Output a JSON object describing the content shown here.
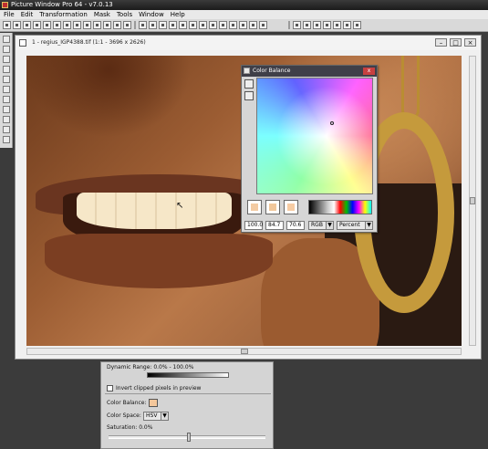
{
  "app": {
    "title": "Picture Window Pro 64 - v7.0.13"
  },
  "menu": [
    "File",
    "Edit",
    "Transformation",
    "Mask",
    "Tools",
    "Window",
    "Help"
  ],
  "doc": {
    "title": "1 - regius_IGP4388.tif (1:1 - 3696 x 2626)"
  },
  "color_balance": {
    "title": "Color Balance",
    "values": [
      "100.0",
      "84.7",
      "70.6"
    ],
    "mode": "RGB",
    "units": "Percent",
    "swatch_colors": [
      "#f3cba3",
      "#f1c79b",
      "#f7cca4"
    ]
  },
  "panel": {
    "dynamic_range": "Dynamic Range: 0.0% - 100.0%",
    "invert_clipped": "Invert clipped pixels in preview",
    "color_balance_label": "Color Balance:",
    "color_space_label": "Color Space:",
    "color_space_value": "HSV",
    "saturation": "Saturation: 0.0%"
  },
  "colors": {
    "titlebar": "#1e1e1e",
    "dialog_title": "#3f3f48",
    "close": "#c74040"
  }
}
